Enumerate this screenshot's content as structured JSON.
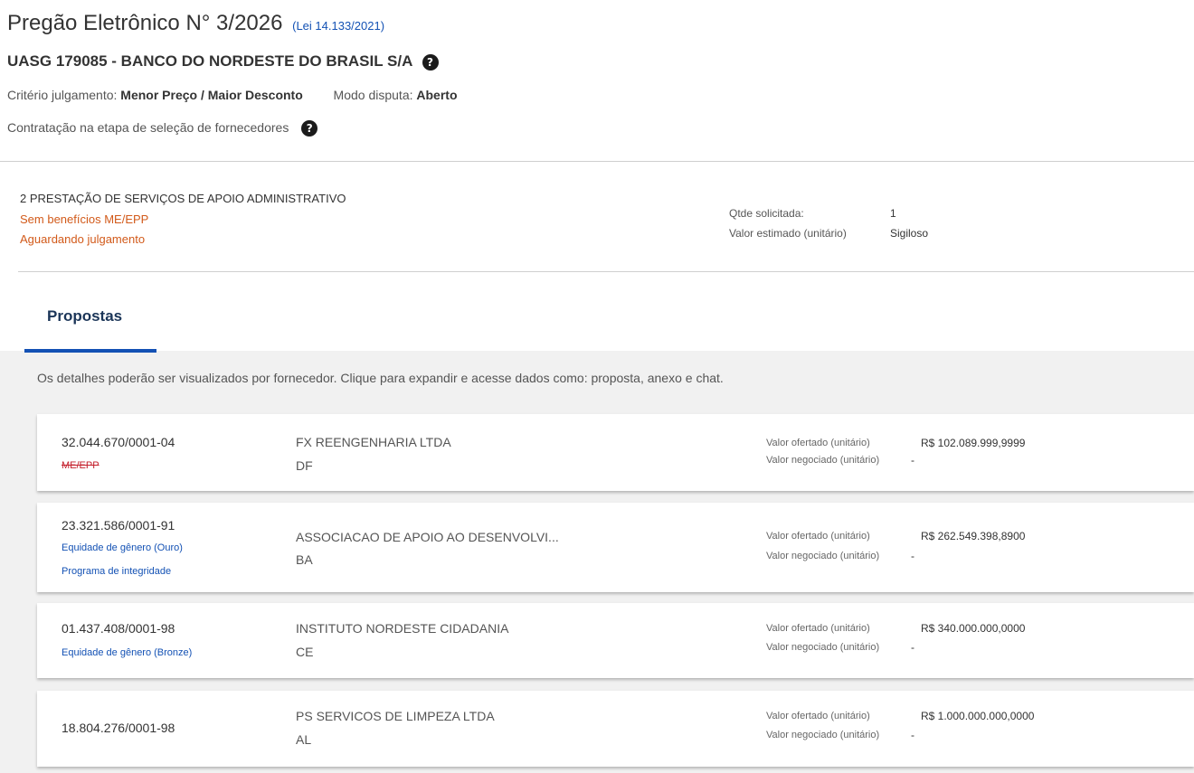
{
  "header": {
    "title": "Pregão Eletrônico N° 3/2026",
    "law": "(Lei 14.133/2021)",
    "uasg": "UASG 179085 - BANCO DO NORDESTE DO BRASIL S/A",
    "criteria_label": "Critério julgamento:",
    "criteria_value": "Menor Preço / Maior Desconto",
    "mode_label": "Modo disputa:",
    "mode_value": "Aberto",
    "contract_text": "Contratação na etapa de seleção de fornecedores",
    "help_glyph": "?"
  },
  "item": {
    "title": "2  PRESTAÇÃO DE SERVIÇOS DE APOIO ADMINISTRATIVO",
    "benefit": "Sem benefícios ME/EPP",
    "status": "Aguardando julgamento",
    "qty_label": "Qtde solicitada:",
    "qty_value": "1",
    "est_label": "Valor estimado (unitário)",
    "est_value": "Sigiloso",
    "status_color": "#d25a1a"
  },
  "tabs": {
    "proposals": "Propostas"
  },
  "panel": {
    "description": "Os detalhes poderão ser visualizados por fornecedor. Clique para expandir e acesse dados como: proposta, anexo e chat."
  },
  "labels": {
    "offered": "Valor ofertado (unitário)",
    "negotiated": "Valor negociado (unitário)"
  },
  "proposals": [
    {
      "cnpj": "32.044.670/0001-04",
      "tags_struck": [
        "ME/EPP"
      ],
      "tags": [],
      "name": "FX REENGENHARIA LTDA",
      "uf": "DF",
      "offered": "R$ 102.089.999,9999",
      "negotiated": "-"
    },
    {
      "cnpj": "23.321.586/0001-91",
      "tags_struck": [],
      "tags": [
        "Equidade de gênero (Ouro)",
        "Programa de integridade"
      ],
      "name": "ASSOCIACAO DE APOIO AO DESENVOLVI...",
      "uf": "BA",
      "offered": "R$ 262.549.398,8900",
      "negotiated": "-"
    },
    {
      "cnpj": "01.437.408/0001-98",
      "tags_struck": [],
      "tags": [
        "Equidade de gênero (Bronze)"
      ],
      "name": "INSTITUTO NORDESTE CIDADANIA",
      "uf": "CE",
      "offered": "R$ 340.000.000,0000",
      "negotiated": "-"
    },
    {
      "cnpj": "18.804.276/0001-98",
      "tags_struck": [],
      "tags": [],
      "name": "PS SERVICOS DE LIMPEZA LTDA",
      "uf": "AL",
      "offered": "R$ 1.000.000.000,0000",
      "negotiated": "-"
    }
  ],
  "colors": {
    "link": "#1351b4",
    "struck": "#c4202c",
    "tab_title": "#1b3558"
  }
}
